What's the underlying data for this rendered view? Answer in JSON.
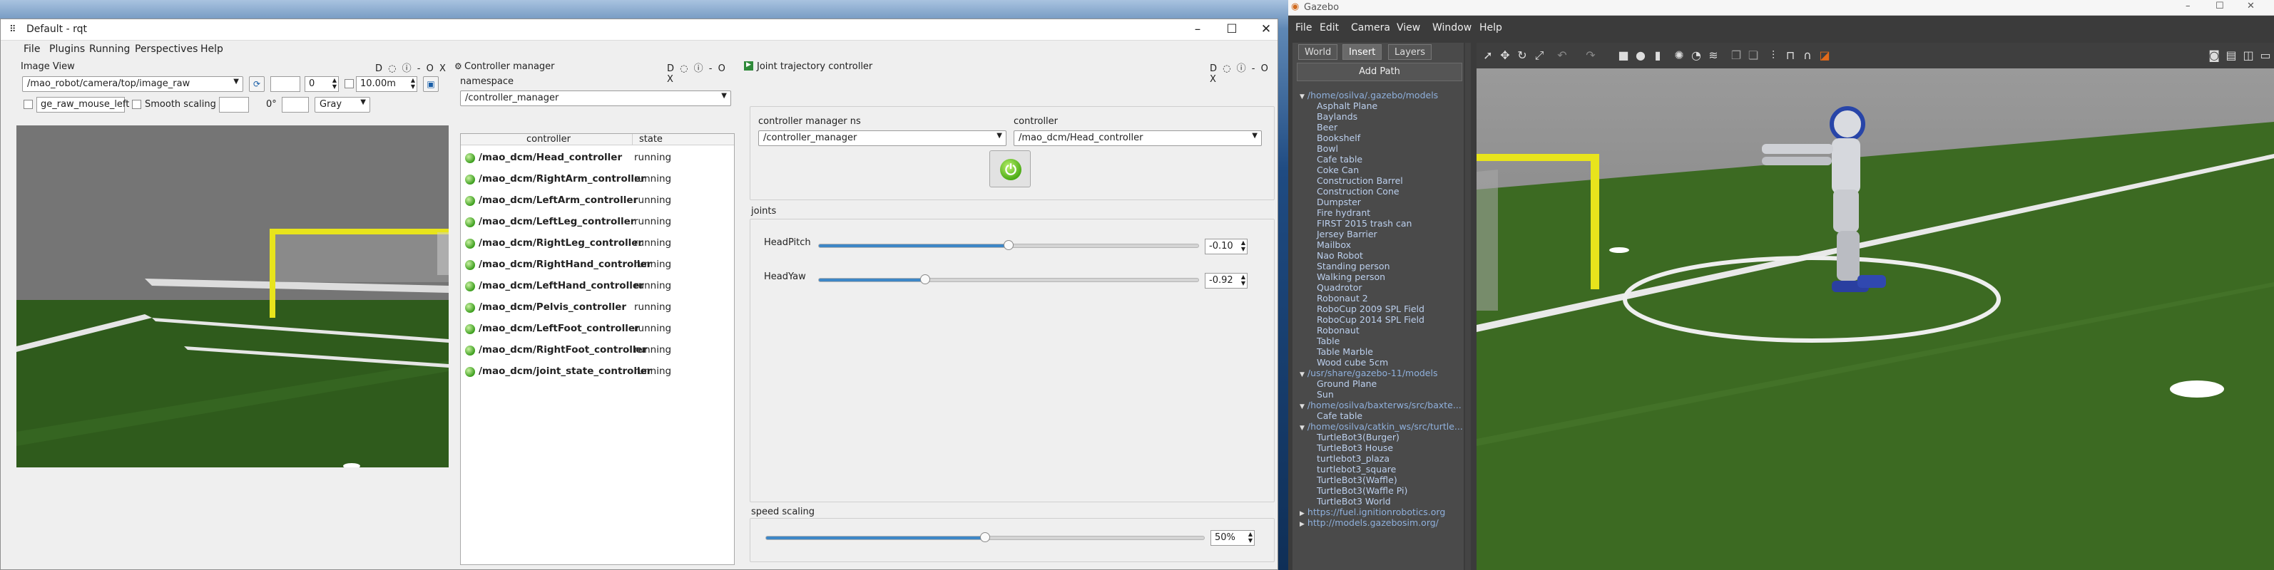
{
  "rqt": {
    "title": "Default - rqt",
    "menu": [
      "File",
      "Plugins",
      "Running",
      "Perspectives",
      "Help"
    ],
    "image_view": {
      "title": "Image View",
      "dock_buttons": "D ◌ ⓘ - O X",
      "topic": "/mao_robot/camera/top/image_raw",
      "spin1": "0",
      "spin2": "10.00m",
      "mouse_topic": "ge_raw_mouse_left",
      "smooth_label": "Smooth scaling",
      "rotation": "0°",
      "color_mode": "Gray"
    },
    "controller_manager": {
      "title": "Controller manager",
      "namespace_label": "namespace",
      "namespace": "/controller_manager",
      "col_controller": "controller",
      "col_state": "state",
      "controllers": [
        {
          "name": "/mao_dcm/Head_controller",
          "state": "running"
        },
        {
          "name": "/mao_dcm/RightArm_controller",
          "state": "running"
        },
        {
          "name": "/mao_dcm/LeftArm_controller",
          "state": "running"
        },
        {
          "name": "/mao_dcm/LeftLeg_controller",
          "state": "running"
        },
        {
          "name": "/mao_dcm/RightLeg_controller",
          "state": "running"
        },
        {
          "name": "/mao_dcm/RightHand_controller",
          "state": "running"
        },
        {
          "name": "/mao_dcm/LeftHand_controller",
          "state": "running"
        },
        {
          "name": "/mao_dcm/Pelvis_controller",
          "state": "running"
        },
        {
          "name": "/mao_dcm/LeftFoot_controller",
          "state": "running"
        },
        {
          "name": "/mao_dcm/RightFoot_controller",
          "state": "running"
        },
        {
          "name": "/mao_dcm/joint_state_controller",
          "state": "running"
        }
      ]
    },
    "joint_trajectory": {
      "title": "Joint trajectory controller",
      "cm_ns_label": "controller manager ns",
      "cm_ns": "/controller_manager",
      "controller_label": "controller",
      "controller": "/mao_dcm/Head_controller",
      "joints_label": "joints",
      "joints": [
        {
          "name": "HeadPitch",
          "value": "-0.10",
          "level": 0.5
        },
        {
          "name": "HeadYaw",
          "value": "-0.92",
          "level": 0.28
        }
      ],
      "speed_label": "speed scaling",
      "speed_value": "50%",
      "speed_level": 0.5
    }
  },
  "gazebo": {
    "title": "Gazebo",
    "menu": [
      "File",
      "Edit",
      "Camera",
      "View",
      "Window",
      "Help"
    ],
    "tabs": [
      "World",
      "Insert",
      "Layers"
    ],
    "add_path": "Add Path",
    "tree": [
      {
        "text": "/home/osilva/.gazebo/models",
        "folder": true,
        "open": true
      },
      {
        "text": "Asphalt Plane"
      },
      {
        "text": "Baylands"
      },
      {
        "text": "Beer"
      },
      {
        "text": "Bookshelf"
      },
      {
        "text": "Bowl"
      },
      {
        "text": "Cafe table"
      },
      {
        "text": "Coke Can"
      },
      {
        "text": "Construction Barrel"
      },
      {
        "text": "Construction Cone"
      },
      {
        "text": "Dumpster"
      },
      {
        "text": "Fire hydrant"
      },
      {
        "text": "FIRST 2015 trash can"
      },
      {
        "text": "Jersey Barrier"
      },
      {
        "text": "Mailbox"
      },
      {
        "text": "Nao Robot"
      },
      {
        "text": "Standing person"
      },
      {
        "text": "Walking person"
      },
      {
        "text": "Quadrotor"
      },
      {
        "text": "Robonaut 2"
      },
      {
        "text": "RoboCup 2009 SPL Field"
      },
      {
        "text": "RoboCup 2014 SPL Field"
      },
      {
        "text": "Robonaut"
      },
      {
        "text": "Table"
      },
      {
        "text": "Table Marble"
      },
      {
        "text": "Wood cube 5cm"
      },
      {
        "text": "/usr/share/gazebo-11/models",
        "folder": true,
        "open": true
      },
      {
        "text": "Ground Plane"
      },
      {
        "text": "Sun"
      },
      {
        "text": "/home/osilva/baxterws/src/baxte...",
        "folder": true,
        "open": true
      },
      {
        "text": "Cafe table"
      },
      {
        "text": "/home/osilva/catkin_ws/src/turtle...",
        "folder": true,
        "open": true
      },
      {
        "text": "TurtleBot3(Burger)"
      },
      {
        "text": "TurtleBot3 House"
      },
      {
        "text": "turtlebot3_plaza"
      },
      {
        "text": "turtlebot3_square"
      },
      {
        "text": "TurtleBot3(Waffle)"
      },
      {
        "text": "TurtleBot3(Waffle Pi)"
      },
      {
        "text": "TurtleBot3 World"
      },
      {
        "text": "https://fuel.ignitionrobotics.org",
        "folder": true,
        "open": false
      },
      {
        "text": "http://models.gazebosim.org/",
        "folder": true,
        "open": false
      }
    ]
  },
  "colors": {
    "accent": "#3d86c6",
    "field": "#3c6a22",
    "goal": "#e8e41c"
  },
  "icons": {
    "power": "power-button-icon",
    "refresh": "refresh-icon"
  }
}
